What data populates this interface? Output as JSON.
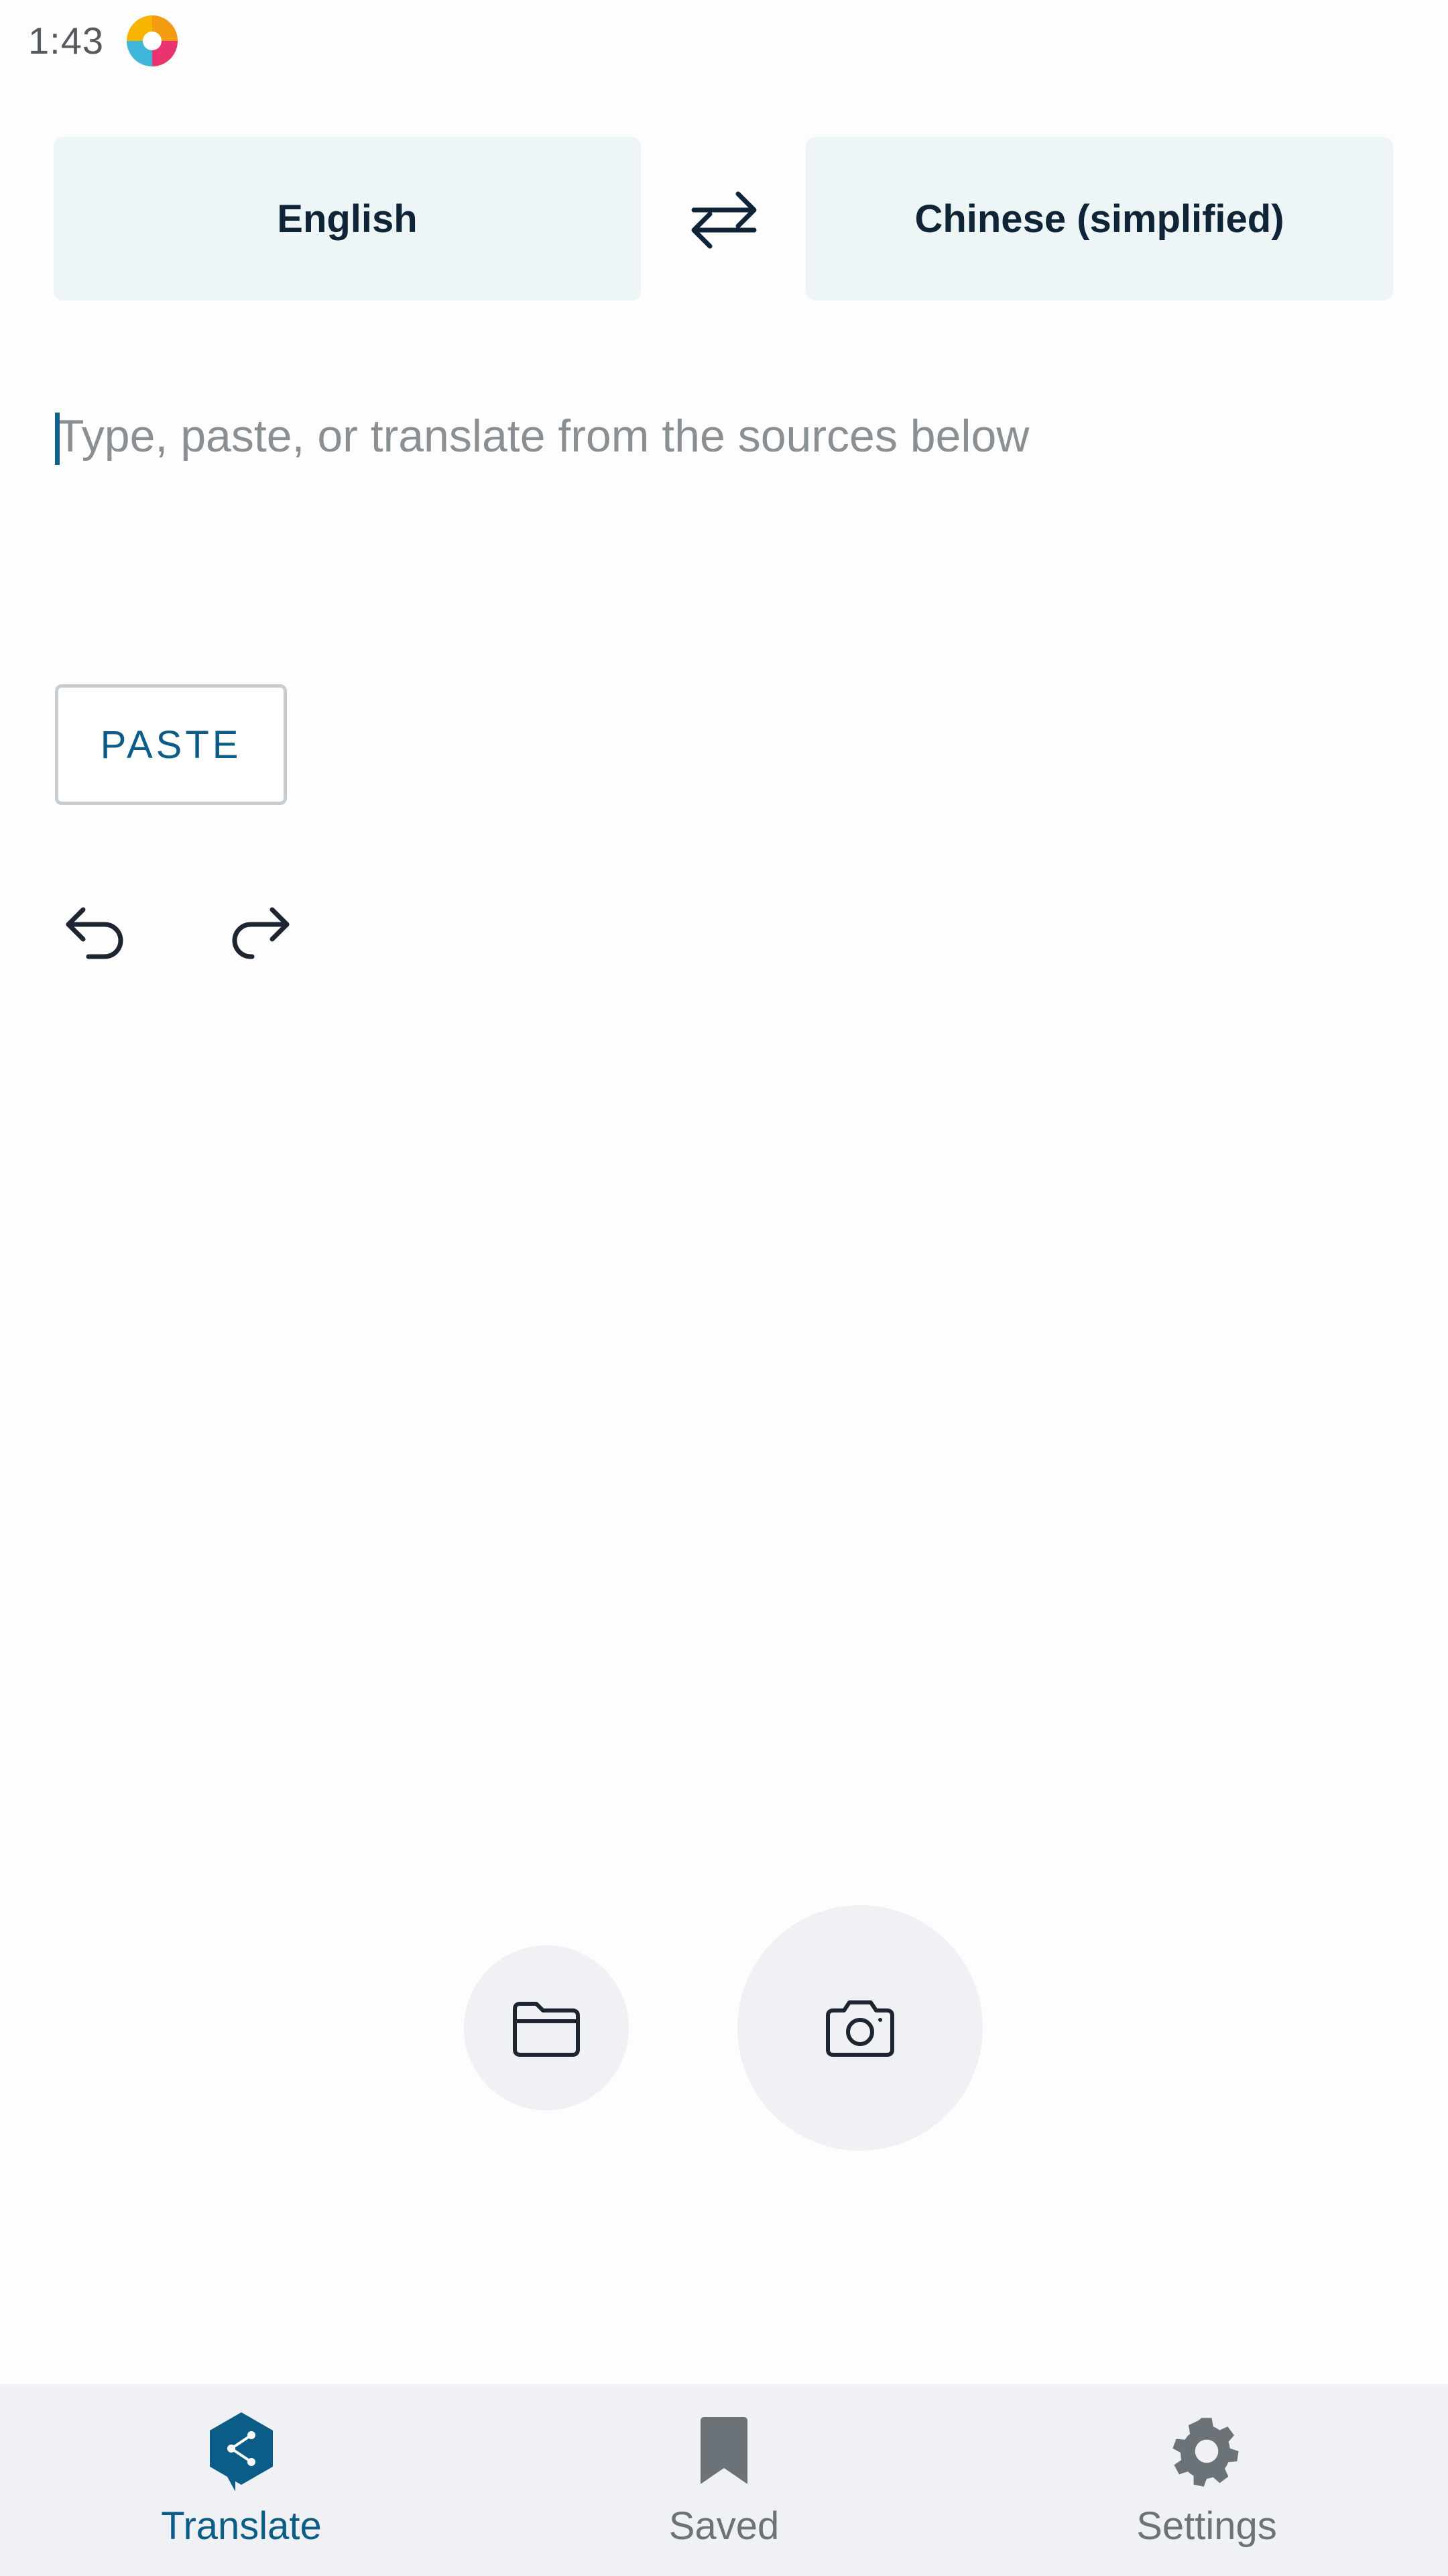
{
  "status_bar": {
    "time": "1:43",
    "app_icon": "colorful-app-logo-icon"
  },
  "languages": {
    "source": "English",
    "target": "Chinese (simplified)",
    "swap_icon": "swap-arrows-icon"
  },
  "input": {
    "value": "",
    "placeholder": "Type, paste, or translate from the sources below"
  },
  "actions": {
    "paste_label": "PASTE",
    "undo_icon": "undo-icon",
    "redo_icon": "redo-icon",
    "file_icon": "folder-icon",
    "camera_icon": "camera-icon"
  },
  "bottom_nav": {
    "items": [
      {
        "label": "Translate",
        "icon": "translate-logo-icon",
        "active": true
      },
      {
        "label": "Saved",
        "icon": "bookmark-icon",
        "active": false
      },
      {
        "label": "Settings",
        "icon": "gear-icon",
        "active": false
      }
    ]
  },
  "colors": {
    "accent": "#0b5c87",
    "language_button_bg": "#eef5f7",
    "nav_bg": "#f0f1f5",
    "inactive": "#6b7278"
  }
}
